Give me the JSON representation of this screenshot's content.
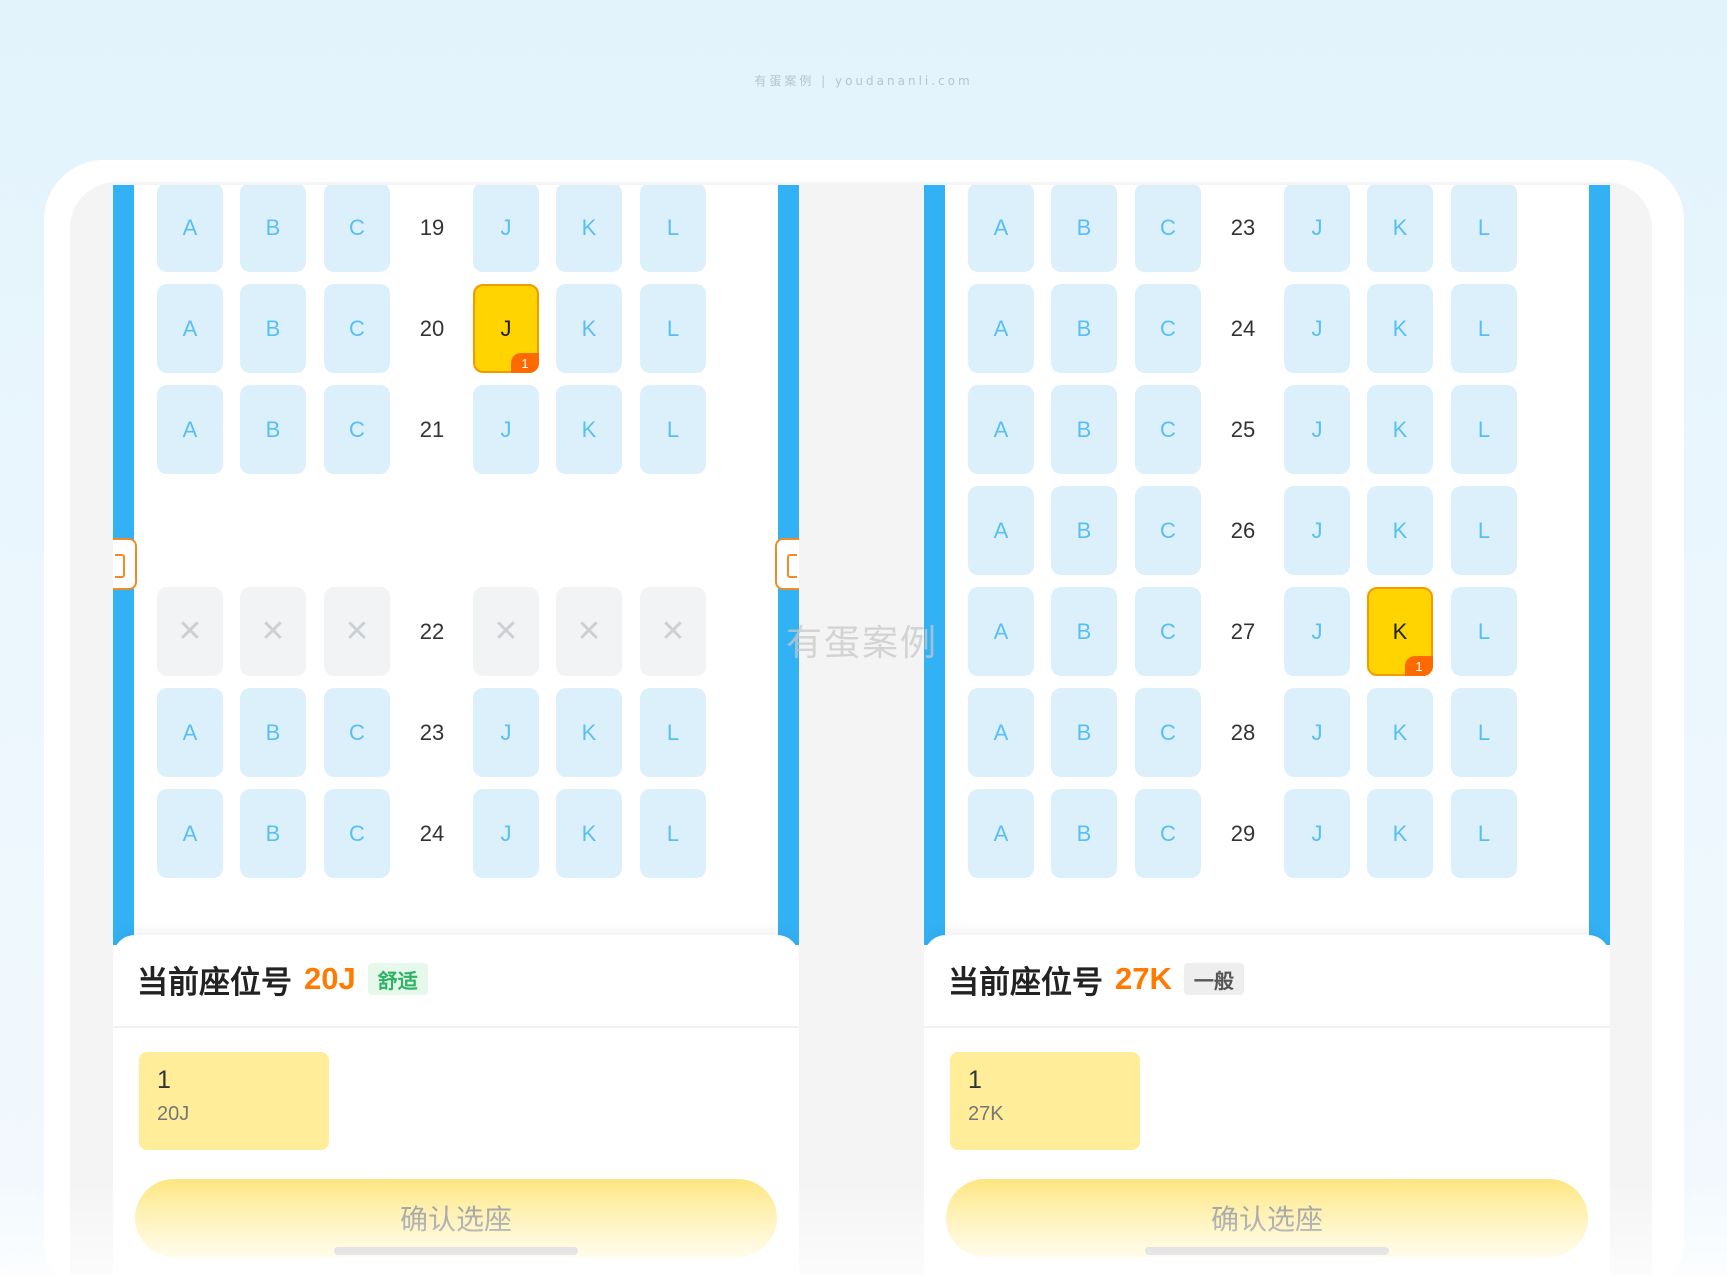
{
  "watermark_top": "有蛋案例 | youdananli.com",
  "watermark_center": "有蛋案例",
  "seat_letters": [
    "A",
    "B",
    "C",
    "J",
    "K",
    "L"
  ],
  "blocked_symbol": "✕",
  "panels": [
    {
      "rows": [
        {
          "num": "19",
          "blocked": false
        },
        {
          "num": "20",
          "blocked": false,
          "selected": "J"
        },
        {
          "num": "21",
          "blocked": false
        },
        {
          "num": "",
          "gap": true
        },
        {
          "num": "22",
          "blocked": true
        },
        {
          "num": "23",
          "blocked": false
        },
        {
          "num": "24",
          "blocked": false
        }
      ],
      "selected_badge": "1",
      "sheet": {
        "title": "当前座位号",
        "seat": "20J",
        "tag": "舒适",
        "tag_color": "#2bb463",
        "passenger_num": "1",
        "passenger_seat": "20J",
        "confirm": "确认选座"
      }
    },
    {
      "rows": [
        {
          "num": "23",
          "blocked": false
        },
        {
          "num": "24",
          "blocked": false
        },
        {
          "num": "25",
          "blocked": false
        },
        {
          "num": "26",
          "blocked": false
        },
        {
          "num": "27",
          "blocked": false,
          "selected": "K"
        },
        {
          "num": "28",
          "blocked": false
        },
        {
          "num": "29",
          "blocked": false
        }
      ],
      "selected_badge": "1",
      "sheet": {
        "title": "当前座位号",
        "seat": "27K",
        "tag": "一般",
        "tag_color": "#555555",
        "passenger_num": "1",
        "passenger_seat": "27K",
        "confirm": "确认选座"
      }
    }
  ],
  "colors": {
    "accent_rail": "#33b1f5",
    "seat_available": "#dcf0fc",
    "seat_selected": "#ffd400",
    "seat_price_orange": "#ff7a00",
    "badge": "#ff6a00"
  }
}
